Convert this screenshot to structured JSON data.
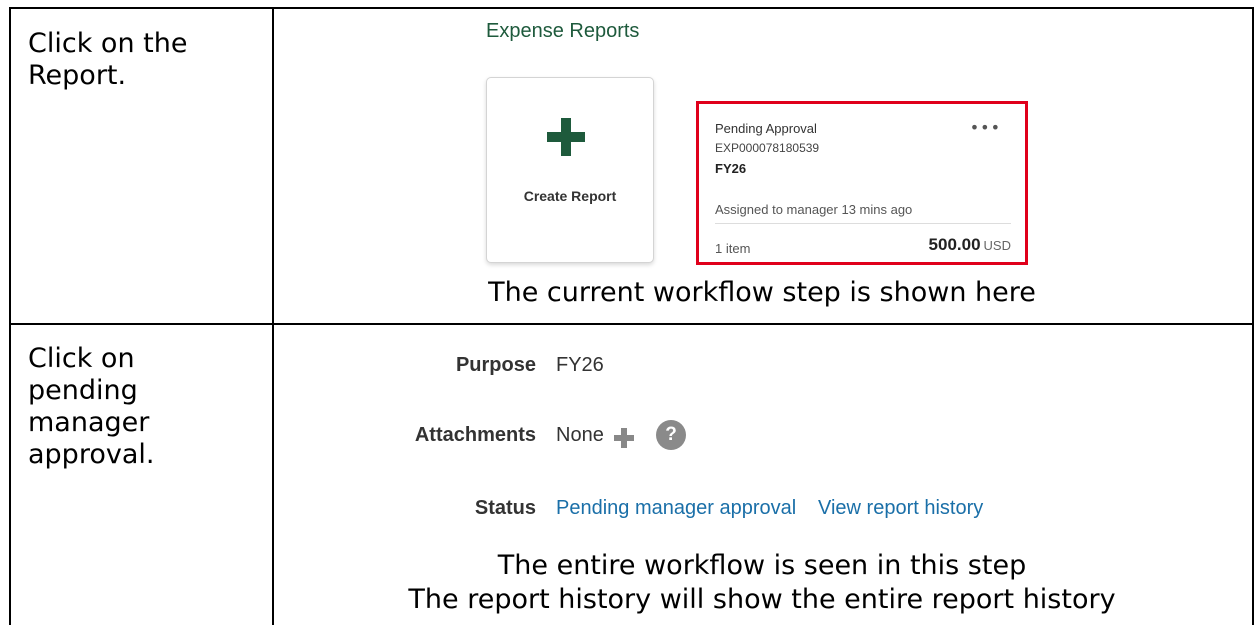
{
  "rows": [
    {
      "instruction_lines": [
        "Click on the",
        "Report."
      ],
      "screen": {
        "section_title": "Expense Reports",
        "create_card": {
          "label": "Create Report",
          "icon": "plus-icon"
        },
        "report_card": {
          "status": "Pending Approval",
          "menu_icon": "more-options-icon",
          "report_number": "EXP000078180539",
          "purpose": "FY26",
          "assigned": "Assigned to manager 13 mins ago",
          "items": "1 item",
          "amount": "500.00",
          "currency": "USD",
          "highlight_color": "#e0001b"
        }
      },
      "caption_lines": [
        "The current workflow step is shown here"
      ]
    },
    {
      "instruction_lines": [
        "Click on",
        "pending",
        "manager",
        "approval."
      ],
      "screen": {
        "purpose_label": "Purpose",
        "purpose_value": "FY26",
        "attachments_label": "Attachments",
        "attachments_value": "None",
        "status_label": "Status",
        "status_value": "Pending manager approval",
        "history_link": "View report history"
      },
      "caption_lines": [
        "The entire workflow is seen in this step",
        "The report history will show the entire report history"
      ]
    }
  ],
  "colors": {
    "brand_green": "#1e5a3c",
    "link_blue": "#1a6fa8"
  }
}
